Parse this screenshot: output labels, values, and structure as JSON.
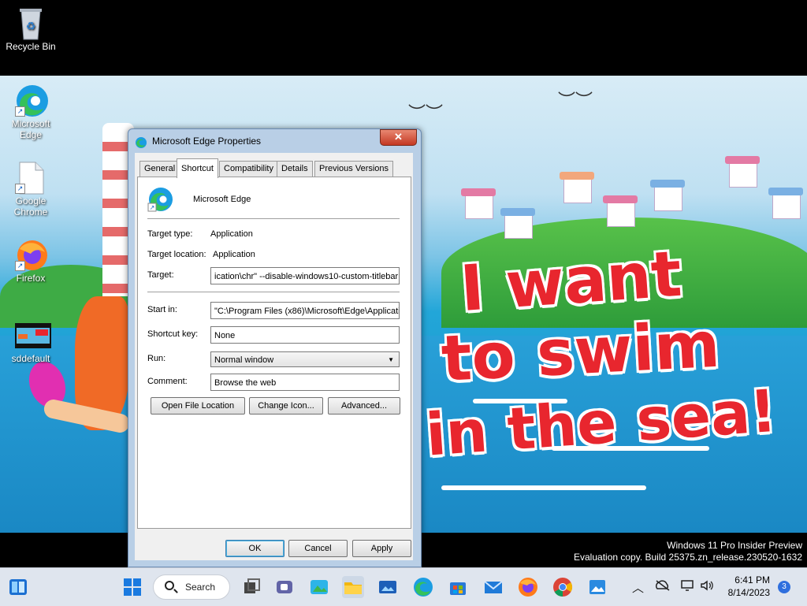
{
  "desktop": {
    "icons": [
      {
        "label": "Recycle Bin"
      },
      {
        "label": "Microsoft Edge"
      },
      {
        "label": "Google Chrome"
      },
      {
        "label": "Firefox"
      },
      {
        "label": "sddefault"
      }
    ],
    "wallpaper_text": [
      "I want",
      "to swim",
      "in the sea!"
    ]
  },
  "dialog": {
    "title": "Microsoft Edge Properties",
    "close_glyph": "✕",
    "tabs": [
      {
        "label": "General"
      },
      {
        "label": "Shortcut"
      },
      {
        "label": "Compatibility"
      },
      {
        "label": "Details"
      },
      {
        "label": "Previous Versions"
      }
    ],
    "active_tab": "Shortcut",
    "app_name": "Microsoft Edge",
    "fields": {
      "target_type_label": "Target type:",
      "target_type_value": "Application",
      "target_location_label": "Target location:",
      "target_location_value": "Application",
      "target_label": "Target:",
      "target_value": "ication\\chr\" --disable-windows10-custom-titlebar",
      "start_in_label": "Start in:",
      "start_in_value": "\"C:\\Program Files (x86)\\Microsoft\\Edge\\Applicati",
      "shortcut_key_label": "Shortcut key:",
      "shortcut_key_value": "None",
      "run_label": "Run:",
      "run_value": "Normal window",
      "comment_label": "Comment:",
      "comment_value": "Browse the web"
    },
    "buttons": {
      "open_file_location": "Open File Location",
      "change_icon": "Change Icon...",
      "advanced": "Advanced...",
      "ok": "OK",
      "cancel": "Cancel",
      "apply": "Apply"
    }
  },
  "watermark": {
    "line1": "Windows 11 Pro Insider Preview",
    "line2": "Evaluation copy. Build 25375.zn_release.230520-1632"
  },
  "taskbar": {
    "search_label": "Search",
    "clock_time": "6:41 PM",
    "clock_date": "8/14/2023",
    "notification_count": "3"
  },
  "colors": {
    "accent": "#2f6fde",
    "slogan_red": "#e8262e",
    "titlebar_close": "#c43822"
  }
}
